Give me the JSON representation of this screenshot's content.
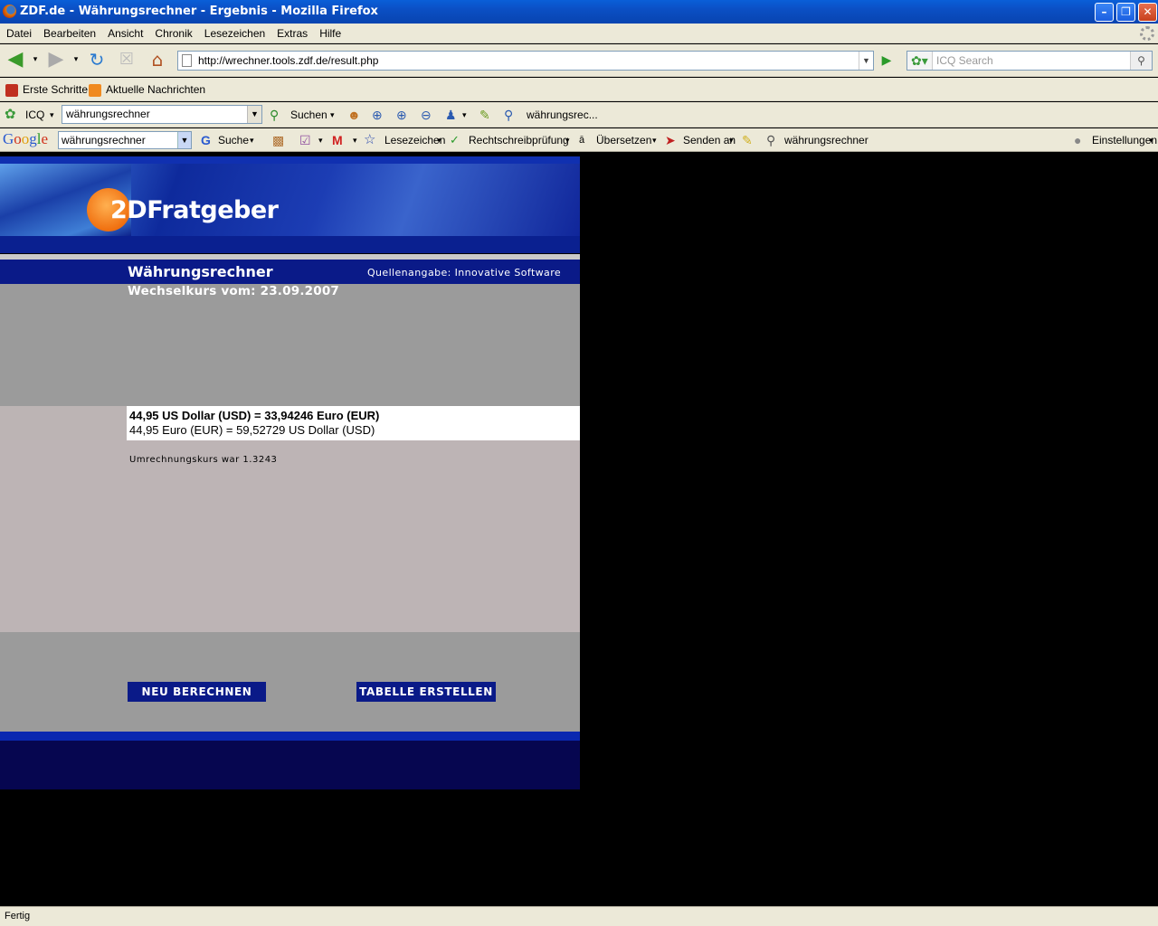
{
  "window": {
    "title": "ZDF.de - Währungsrechner - Ergebnis - Mozilla Firefox"
  },
  "menu": [
    "Datei",
    "Bearbeiten",
    "Ansicht",
    "Chronik",
    "Lesezeichen",
    "Extras",
    "Hilfe"
  ],
  "nav": {
    "url": "http://wrechner.tools.zdf.de/result.php",
    "search_placeholder": "ICQ Search"
  },
  "bookmarks": [
    "Erste Schritte",
    "Aktuelle Nachrichten"
  ],
  "icq_toolbar": {
    "label": "ICQ",
    "query": "währungsrechner",
    "search_label": "Suchen",
    "tab_label": "währungsrec..."
  },
  "google_toolbar": {
    "logo": "Google",
    "query": "währungsrechner",
    "search_label": "Suche",
    "bookmarks_label": "Lesezeichen",
    "spellcheck_label": "Rechtschreibprüfung",
    "translate_label": "Übersetzen",
    "send_label": "Senden an",
    "highlight_term": "währungsrechner",
    "settings_label": "Einstellungen"
  },
  "page": {
    "logo_zdf": "2DF",
    "logo_rest": "ratgeber",
    "title": "Währungsrechner",
    "source": "Quellenangabe: Innovative Software",
    "date_line": "Wechselkurs vom: 23.09.2007",
    "result_primary": "44,95 US Dollar (USD) = 33,94246 Euro (EUR)",
    "result_secondary": "44,95 Euro (EUR) = 59,52729 US Dollar (USD)",
    "rate_line": "Umrechnungskurs war 1.3243",
    "btn_recalc": "NEU BERECHNEN",
    "btn_table": "TABELLE ERSTELLEN"
  },
  "status": "Fertig"
}
